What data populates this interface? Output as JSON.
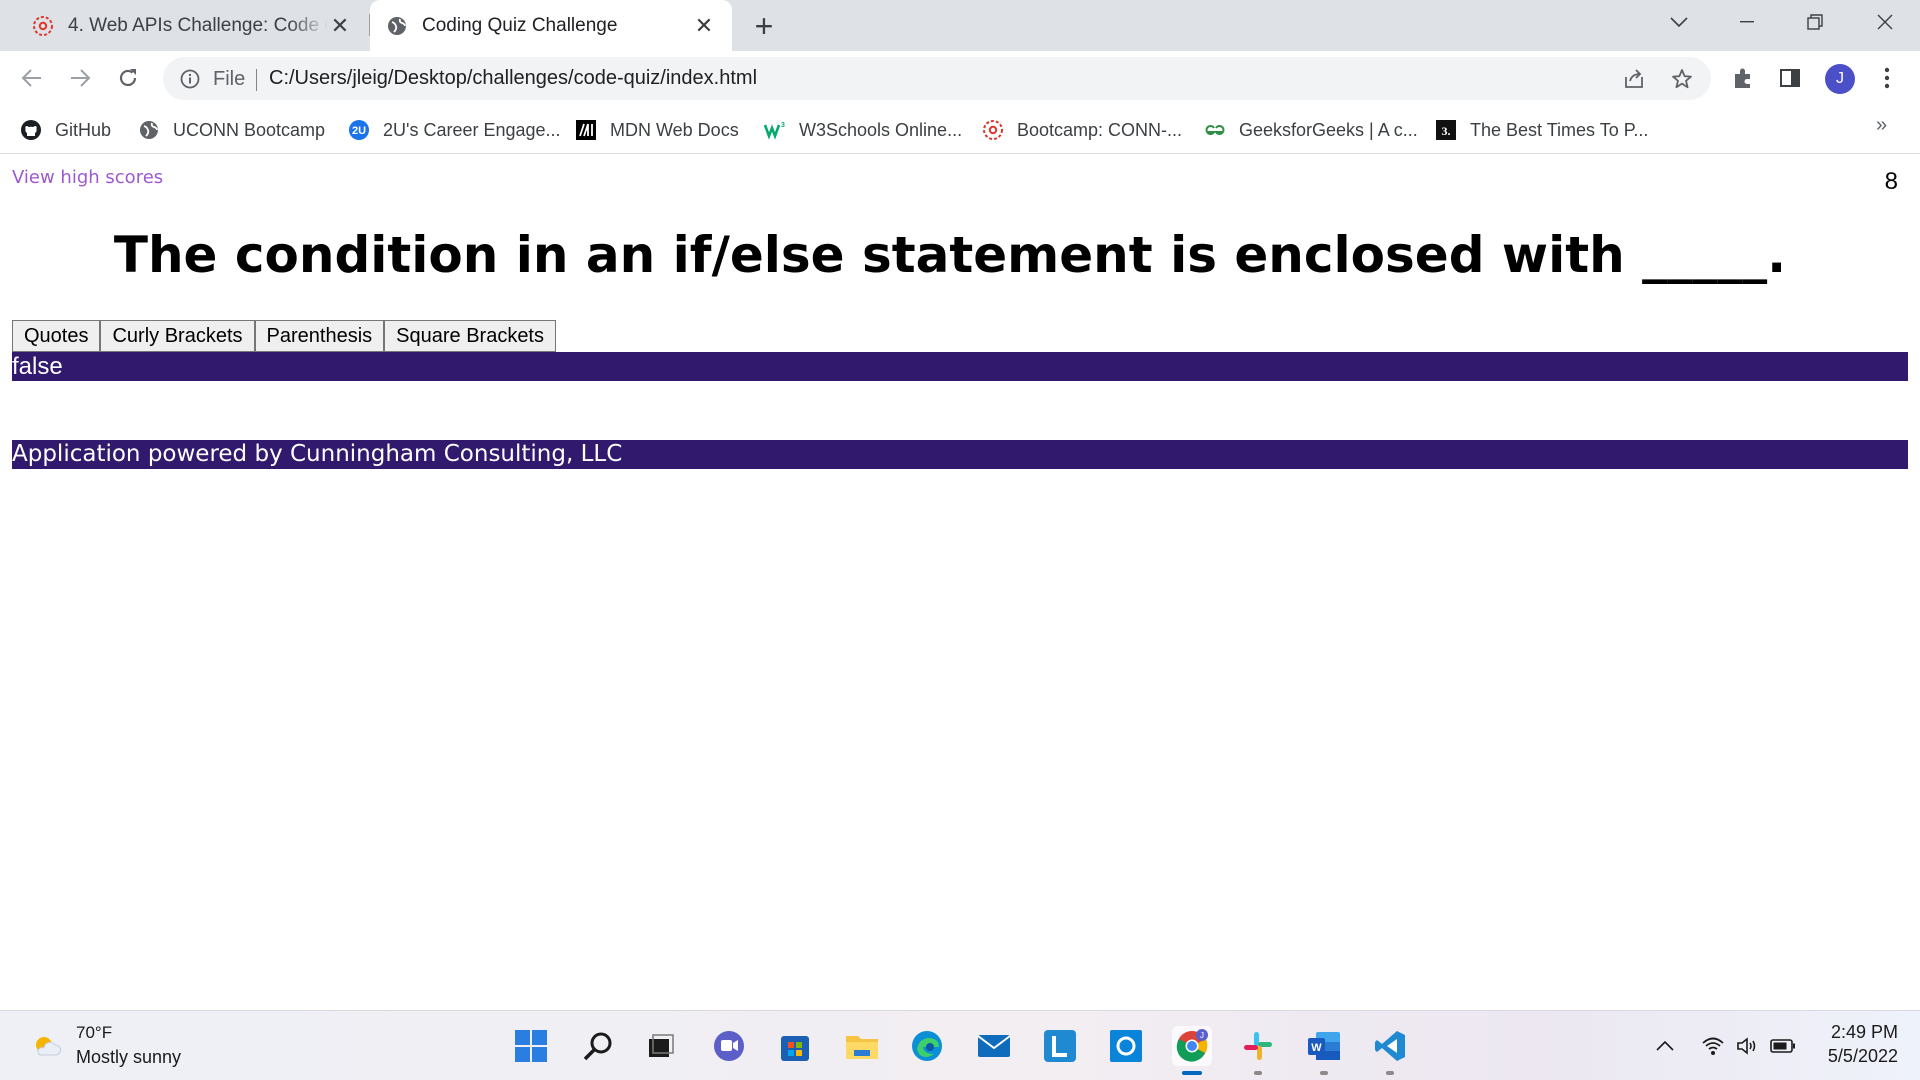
{
  "browser": {
    "tabs": [
      {
        "title": "4. Web APIs Challenge: Code Quiz",
        "icon": "canvas-red-icon",
        "active": false
      },
      {
        "title": "Coding Quiz Challenge",
        "icon": "globe-icon",
        "active": true
      }
    ],
    "omnibox": {
      "scheme_label": "File",
      "url": "C:/Users/jleig/Desktop/challenges/code-quiz/index.html"
    },
    "profile_initial": "J",
    "bookmarks": [
      {
        "label": "GitHub",
        "icon": "github-icon"
      },
      {
        "label": "UCONN Bootcamp",
        "icon": "globe-icon"
      },
      {
        "label": "2U's Career Engage...",
        "icon": "2u-icon"
      },
      {
        "label": "MDN Web Docs",
        "icon": "mdn-icon"
      },
      {
        "label": "W3Schools Online...",
        "icon": "w3schools-icon"
      },
      {
        "label": "Bootcamp: CONN-...",
        "icon": "canvas-red-icon"
      },
      {
        "label": "GeeksforGeeks | A c...",
        "icon": "geeksforgeeks-icon"
      },
      {
        "label": "The Best Times To P...",
        "icon": "bookmark-dark-icon"
      }
    ],
    "bookmarks_more": "»"
  },
  "page": {
    "high_scores_link": "View high scores",
    "timer": "8",
    "question": "The condition in an if/else statement is enclosed with _____.",
    "answers": [
      "Quotes",
      "Curly Brackets",
      "Parenthesis",
      "Square Brackets"
    ],
    "result": "false",
    "footer": "Application powered by Cunningham Consulting, LLC"
  },
  "taskbar": {
    "weather": {
      "temp": "70°F",
      "desc": "Mostly sunny"
    },
    "apps": [
      "start-icon",
      "search-icon",
      "task-view-icon",
      "teams-chat-icon",
      "microsoft-store-icon",
      "file-explorer-icon",
      "edge-icon",
      "mail-icon",
      "l-app-icon",
      "cortana-icon",
      "chrome-icon",
      "slack-icon",
      "word-icon",
      "vscode-icon"
    ],
    "clock": {
      "time": "2:49 PM",
      "date": "5/5/2022"
    }
  },
  "colors": {
    "bar_purple": "#31196e",
    "link_purple": "#9c59d1"
  }
}
